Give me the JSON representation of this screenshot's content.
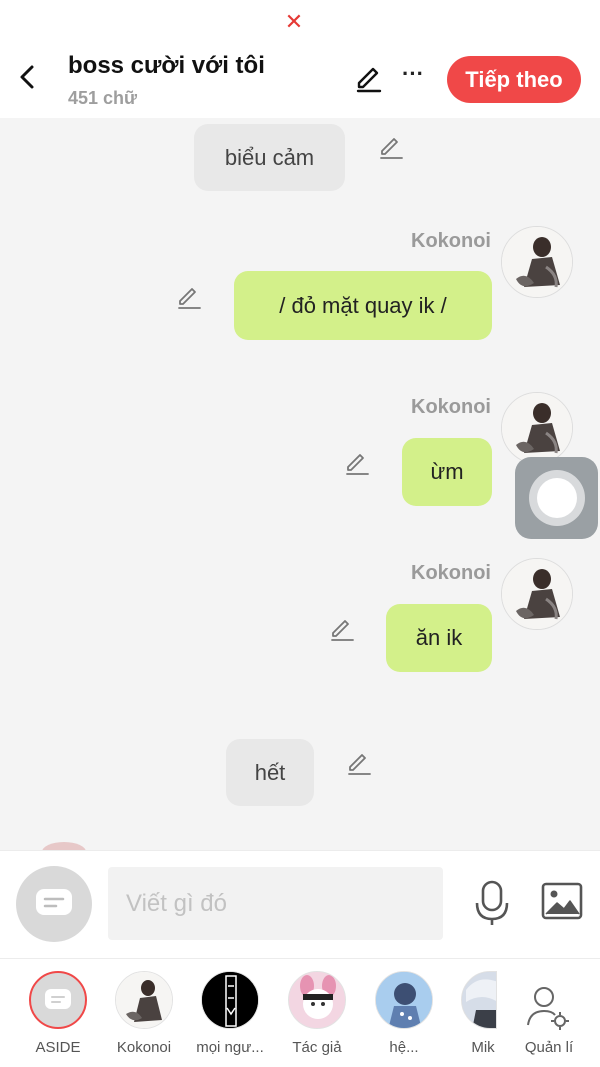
{
  "header": {
    "title": "boss cười với tôi",
    "word_count": "451 chữ",
    "next_label": "Tiếp theo",
    "more_label": "···"
  },
  "messages": [
    {
      "type": "aside",
      "text": "biểu cảm"
    },
    {
      "type": "character",
      "sender": "Kokonoi",
      "text": "/ đỏ mặt quay ik /"
    },
    {
      "type": "character",
      "sender": "Kokonoi",
      "text": "ừm"
    },
    {
      "type": "character",
      "sender": "Kokonoi",
      "text": "ăn ik"
    },
    {
      "type": "aside",
      "text": "hết"
    }
  ],
  "composer": {
    "placeholder": "Viết gì đó"
  },
  "characters": [
    {
      "label": "ASIDE",
      "selected": true
    },
    {
      "label": "Kokonoi"
    },
    {
      "label": "mọi ngư..."
    },
    {
      "label": "Tác giả"
    },
    {
      "label": "hệ..."
    },
    {
      "label": "Mik"
    },
    {
      "label": "Quản lí"
    }
  ],
  "colors": {
    "accent": "#f04848",
    "close_x": "#e53935",
    "bubble_green": "#d3f08a",
    "bubble_gray": "#e8e8e8",
    "chat_bg": "#f4f4f4"
  }
}
